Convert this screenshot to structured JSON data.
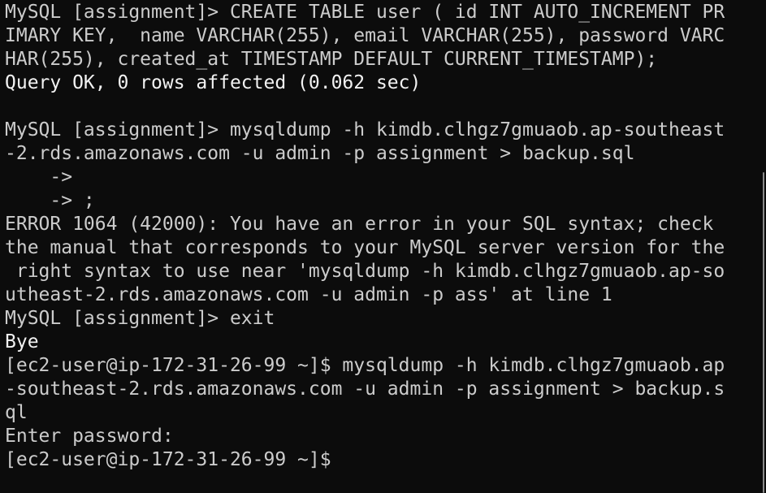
{
  "terminal": {
    "lines": [
      {
        "text": "MySQL [assignment]> CREATE TABLE user ( id INT AUTO_INCREMENT PR"
      },
      {
        "text": "IMARY KEY,  name VARCHAR(255), email VARCHAR(255), password VARC"
      },
      {
        "text": "HAR(255), created_at TIMESTAMP DEFAULT CURRENT_TIMESTAMP);"
      },
      {
        "text": "Query OK, 0 rows affected (0.062 sec)"
      },
      {
        "text": ""
      },
      {
        "text": "MySQL [assignment]> mysqldump -h kimdb.clhgz7gmuaob.ap-southeast"
      },
      {
        "text": "-2.rds.amazonaws.com -u admin -p assignment > backup.sql"
      },
      {
        "text": "    ->"
      },
      {
        "text": "    -> ;"
      },
      {
        "text": "ERROR 1064 (42000): You have an error in your SQL syntax; check"
      },
      {
        "text": "the manual that corresponds to your MySQL server version for the"
      },
      {
        "text": " right syntax to use near 'mysqldump -h kimdb.clhgz7gmuaob.ap-so"
      },
      {
        "text": "utheast-2.rds.amazonaws.com -u admin -p ass' at line 1"
      },
      {
        "text": "MySQL [assignment]> exit"
      },
      {
        "text": "Bye"
      },
      {
        "text": "[ec2-user@ip-172-31-26-99 ~]$ mysqldump -h kimdb.clhgz7gmuaob.ap"
      },
      {
        "text": "-southeast-2.rds.amazonaws.com -u admin -p assignment > backup.s"
      },
      {
        "text": "ql"
      },
      {
        "text": "Enter password:"
      },
      {
        "text": "[ec2-user@ip-172-31-26-99 ~]$ "
      }
    ]
  },
  "colors": {
    "background": "#0c0c0c",
    "foreground": "#cccccc",
    "bright": "#f2f2f2"
  }
}
